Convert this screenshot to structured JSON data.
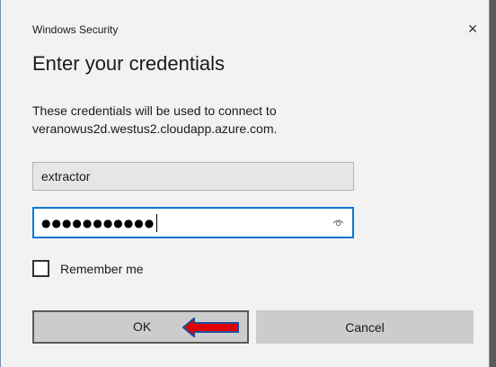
{
  "window": {
    "title": "Windows Security",
    "close_glyph": "×"
  },
  "heading": "Enter your credentials",
  "description_line1": "These credentials will be used to connect to",
  "description_line2": "veranowus2d.westus2.cloudapp.azure.com.",
  "username": {
    "value": "extractor"
  },
  "password": {
    "masked_value": "●●●●●●●●●●●",
    "reveal_icon": "eye-icon"
  },
  "remember": {
    "label": "Remember me",
    "checked": false
  },
  "buttons": {
    "ok": "OK",
    "cancel": "Cancel"
  },
  "annotation": {
    "arrow_color": "#e00000",
    "arrow_outline": "#1f4e9c"
  },
  "colors": {
    "focus_border": "#0078d7",
    "button_bg": "#cccccc",
    "dialog_bg": "#f2f2f2"
  }
}
